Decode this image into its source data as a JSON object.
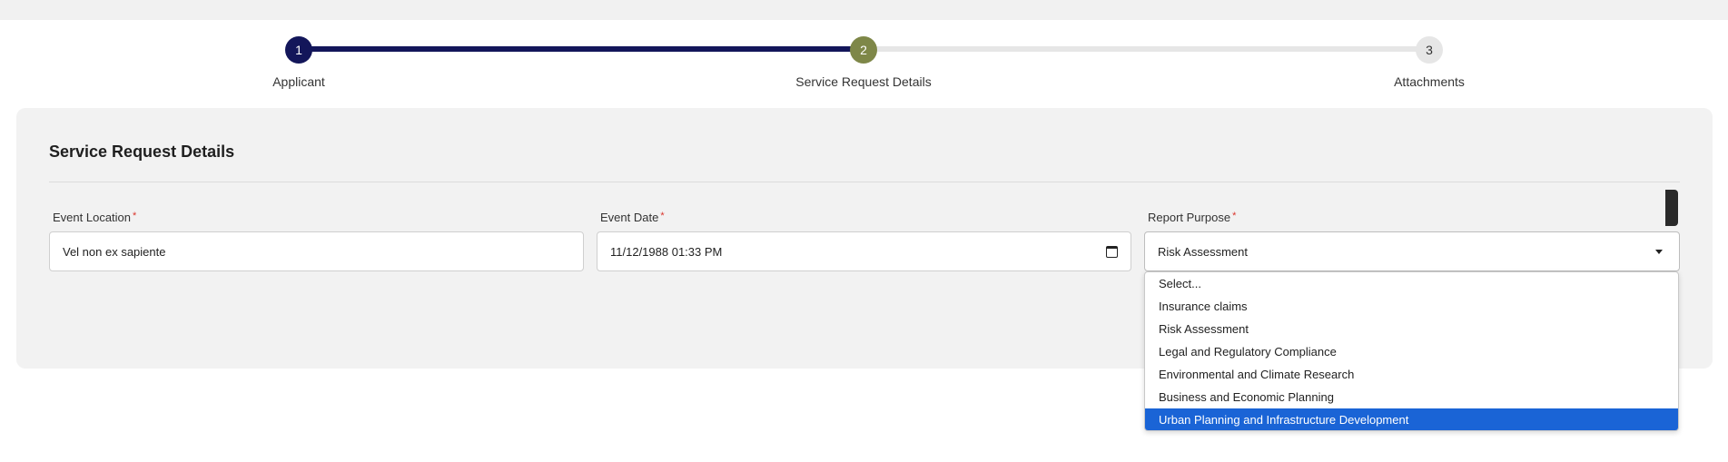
{
  "stepper": {
    "steps": [
      {
        "number": "1",
        "label": "Applicant"
      },
      {
        "number": "2",
        "label": "Service Request Details"
      },
      {
        "number": "3",
        "label": "Attachments"
      }
    ]
  },
  "form": {
    "title": "Service Request Details",
    "fields": {
      "location": {
        "label": "Event Location",
        "required_mark": "*",
        "value": "Vel non ex sapiente"
      },
      "date": {
        "label": "Event Date",
        "required_mark": "*",
        "value": "11/12/1988 01:33 PM"
      },
      "purpose": {
        "label": "Report Purpose",
        "required_mark": "*",
        "value": "Risk Assessment"
      }
    }
  },
  "dropdown": {
    "options": [
      "Select...",
      "Insurance claims",
      "Risk Assessment",
      "Legal and Regulatory Compliance",
      "Environmental and Climate Research",
      "Business and Economic Planning",
      "Urban Planning and Infrastructure Development"
    ],
    "highlighted": "Urban Planning and Infrastructure Development"
  },
  "colors": {
    "step_done": "#13165a",
    "step_current": "#7e8748",
    "step_todo": "#e6e6e6",
    "highlight": "#1a64d6",
    "required": "#d9342b"
  }
}
